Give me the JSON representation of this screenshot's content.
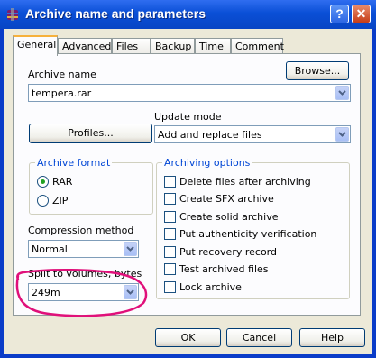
{
  "window": {
    "title": "Archive name and parameters",
    "help_label": "?",
    "close_label": "✕"
  },
  "tabs": [
    {
      "label": "General"
    },
    {
      "label": "Advanced"
    },
    {
      "label": "Files"
    },
    {
      "label": "Backup"
    },
    {
      "label": "Time"
    },
    {
      "label": "Comment"
    }
  ],
  "general": {
    "archive_name_label": "Archive name",
    "archive_name_value": "tempera.rar",
    "browse_label": "Browse...",
    "profiles_label": "Profiles...",
    "update_mode_label": "Update mode",
    "update_mode_value": "Add and replace files",
    "archive_format": {
      "legend": "Archive format",
      "options": [
        {
          "label": "RAR",
          "selected": true
        },
        {
          "label": "ZIP",
          "selected": false
        }
      ]
    },
    "compression_label": "Compression method",
    "compression_value": "Normal",
    "split_label": "Split to volumes, bytes",
    "split_value": "249m",
    "archiving_options": {
      "legend": "Archiving options",
      "items": [
        {
          "label": "Delete files after archiving",
          "checked": false
        },
        {
          "label": "Create SFX archive",
          "checked": false
        },
        {
          "label": "Create solid archive",
          "checked": false
        },
        {
          "label": "Put authenticity verification",
          "checked": false
        },
        {
          "label": "Put recovery record",
          "checked": false
        },
        {
          "label": "Test archived files",
          "checked": false
        },
        {
          "label": "Lock archive",
          "checked": false
        }
      ]
    }
  },
  "footer": {
    "ok_label": "OK",
    "cancel_label": "Cancel",
    "help_label": "Help"
  },
  "colors": {
    "titlebar": "#0a4fd6",
    "dialog_bg": "#ece9d8",
    "group_legend": "#0046d5",
    "annotation_ink": "#e0107a",
    "radio_dot": "#21a121"
  }
}
